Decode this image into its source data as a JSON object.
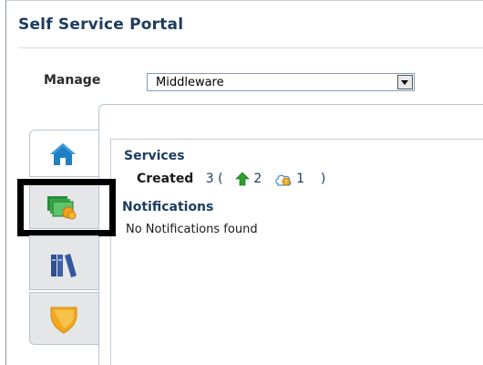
{
  "portal": {
    "title": "Self Service Portal"
  },
  "manage": {
    "label": "Manage",
    "selected": "Middleware"
  },
  "tabs": [
    {
      "icon": "home-icon",
      "state": "active"
    },
    {
      "icon": "services-icon",
      "state": "highlighted"
    },
    {
      "icon": "library-icon",
      "state": "inactive"
    },
    {
      "icon": "shield-icon",
      "state": "inactive"
    }
  ],
  "services": {
    "heading": "Services",
    "created_label": "Created",
    "total": "3",
    "open_paren": "(",
    "up_count": "2",
    "pending_count": "1",
    "close_paren": ")"
  },
  "notifications": {
    "heading": "Notifications",
    "empty_message": "No Notifications found"
  },
  "colors": {
    "title": "#1c3c5e",
    "highlight_border": "#000000",
    "tab_background": "#e4e6e8",
    "home_icon": "#1f7fc4",
    "up_arrow": "#2e9e2e",
    "pending_badge": "#f0a818",
    "shield": "#f2a81e"
  }
}
